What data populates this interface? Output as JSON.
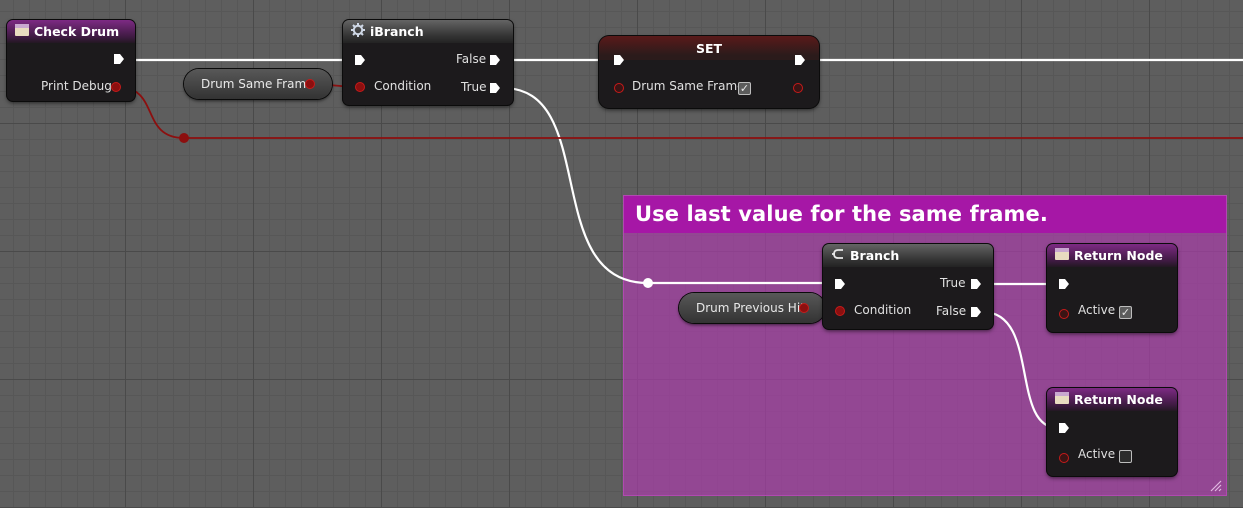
{
  "colors": {
    "exec_wire": "#ffffff",
    "bool_wire": "#8c0f0f",
    "comment_header": "#a617a6",
    "function_header": "#7d2a84"
  },
  "nodes": {
    "check_drum": {
      "title": "Check Drum",
      "icon": "function-entry-icon",
      "pins": {
        "print_debug": "Print Debug"
      }
    },
    "ibranch": {
      "title": "iBranch",
      "icon": "gear-icon",
      "pins": {
        "false": "False",
        "condition": "Condition",
        "true": "True"
      }
    },
    "set": {
      "title": "SET",
      "pins": {
        "var": "Drum Same Frame"
      },
      "checked": true
    },
    "branch": {
      "title": "Branch",
      "icon": "branch-icon",
      "pins": {
        "true": "True",
        "condition": "Condition",
        "false": "False"
      }
    },
    "return_true": {
      "title": "Return Node",
      "icon": "function-entry-icon",
      "pins": {
        "active": "Active"
      },
      "checked": true
    },
    "return_false": {
      "title": "Return Node",
      "icon": "function-entry-icon",
      "pins": {
        "active": "Active"
      },
      "checked": false
    }
  },
  "variables": {
    "drum_same_frame": "Drum Same Frame",
    "drum_previous_hit": "Drum Previous Hit"
  },
  "comment": {
    "title": "Use last value for the same frame."
  }
}
